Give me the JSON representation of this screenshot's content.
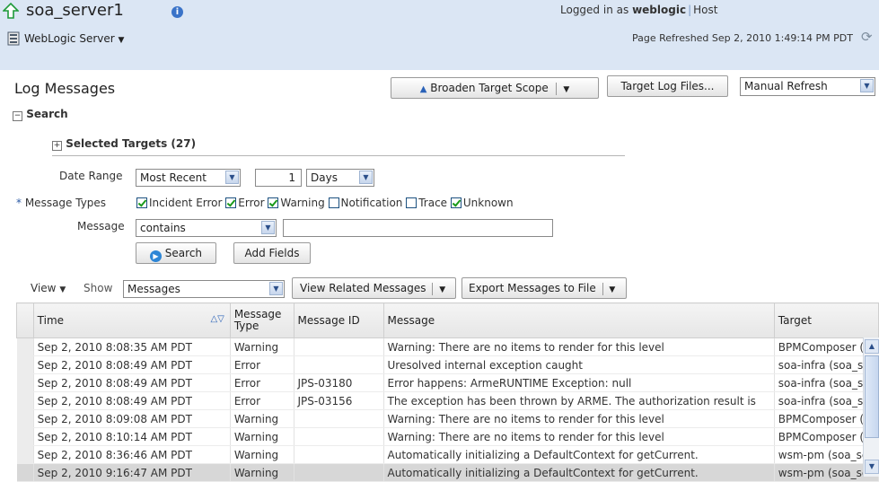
{
  "header": {
    "title": "soa_server1",
    "info_icon": "info-icon",
    "menu": "WebLogic Server",
    "logged_in_prefix": "Logged in as",
    "user": "weblogic",
    "host": "Host",
    "refreshed": "Page Refreshed Sep 2, 2010 1:49:14 PM PDT"
  },
  "page": {
    "title": "Log Messages",
    "broaden": "Broaden Target Scope",
    "target_logs": "Target Log Files...",
    "refresh_mode": "Manual Refresh"
  },
  "search": {
    "heading": "Search",
    "targets": "Selected Targets (27)",
    "date_range_label": "Date Range",
    "date_range_value": "Most Recent",
    "date_count": "1",
    "date_unit": "Days",
    "types_label": "Message Types",
    "types": [
      {
        "label": "Incident Error",
        "checked": true
      },
      {
        "label": "Error",
        "checked": true
      },
      {
        "label": "Warning",
        "checked": true
      },
      {
        "label": "Notification",
        "checked": false
      },
      {
        "label": "Trace",
        "checked": false
      },
      {
        "label": "Unknown",
        "checked": true
      }
    ],
    "message_label": "Message",
    "message_op": "contains",
    "message_value": "",
    "search_btn": "Search",
    "add_fields_btn": "Add Fields"
  },
  "toolbar": {
    "view": "View",
    "show_label": "Show",
    "show_value": "Messages",
    "related": "View Related Messages",
    "export": "Export Messages to File"
  },
  "table": {
    "headers": [
      "Time",
      "Message Type",
      "Message ID",
      "Message",
      "Target"
    ],
    "rows": [
      {
        "time": "Sep 2, 2010 8:08:35 AM PDT",
        "type": "Warning",
        "id": "",
        "message": "Warning: There are no items to render for this level",
        "target": "BPMComposer (:"
      },
      {
        "time": "Sep 2, 2010 8:08:49 AM PDT",
        "type": "Error",
        "id": "",
        "message": "Uresolved internal exception caught",
        "target": "soa-infra (soa_s"
      },
      {
        "time": "Sep 2, 2010 8:08:49 AM PDT",
        "type": "Error",
        "id": "JPS-03180",
        "message": "Error happens: ArmeRUNTIME Exception: null",
        "target": "soa-infra (soa_s"
      },
      {
        "time": "Sep 2, 2010 8:08:49 AM PDT",
        "type": "Error",
        "id": "JPS-03156",
        "message": "The exception has been thrown by ARME. The authorization result is",
        "target": "soa-infra (soa_s"
      },
      {
        "time": "Sep 2, 2010 8:09:08 AM PDT",
        "type": "Warning",
        "id": "",
        "message": "Warning: There are no items to render for this level",
        "target": "BPMComposer (:"
      },
      {
        "time": "Sep 2, 2010 8:10:14 AM PDT",
        "type": "Warning",
        "id": "",
        "message": "Warning: There are no items to render for this level",
        "target": "BPMComposer (:"
      },
      {
        "time": "Sep 2, 2010 8:36:46 AM PDT",
        "type": "Warning",
        "id": "",
        "message": "Automatically initializing a DefaultContext for getCurrent.",
        "target": "wsm-pm (soa_se"
      },
      {
        "time": "Sep 2, 2010 9:16:47 AM PDT",
        "type": "Warning",
        "id": "",
        "message": "Automatically initializing a DefaultContext for getCurrent.",
        "target": "wsm-pm (soa_se"
      }
    ]
  },
  "colors": {
    "header_bg": "#dbe6f4",
    "error": "#d10000",
    "selected_row": "#d7d7d7"
  }
}
